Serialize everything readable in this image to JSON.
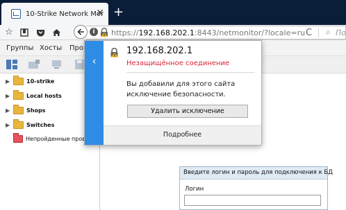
{
  "browser": {
    "tab_title": "10-Strike Network Monito...",
    "tab_close": "✕",
    "new_tab": "+",
    "url_scheme": "https://",
    "url_host": "192.168.202.1",
    "url_rest": ":8443/netmonitor/?locale=ru",
    "search_placeholder": "Поиск",
    "reload_glyph": "C"
  },
  "app": {
    "menu": [
      "Группы",
      "Хосты",
      "Пров"
    ],
    "tree": [
      {
        "label": "10-strike",
        "kind": "folder"
      },
      {
        "label": "Local hosts",
        "kind": "folder"
      },
      {
        "label": "Shops",
        "kind": "folder"
      },
      {
        "label": "Switches",
        "kind": "folder"
      },
      {
        "label": "Непройденные проверки",
        "kind": "failed"
      }
    ],
    "login": {
      "header": "Введите логин и пароль для подключения к БД",
      "login_label": "Логин"
    }
  },
  "popup": {
    "host": "192.168.202.1",
    "warning": "Незащищённое соединение",
    "message": "Вы добавили для этого сайта исключение безопасности.",
    "remove_button": "Удалить исключение",
    "more": "Подробнее",
    "back_glyph": "‹",
    "accent": "#2f8ce6",
    "warning_color": "#d7263a"
  }
}
